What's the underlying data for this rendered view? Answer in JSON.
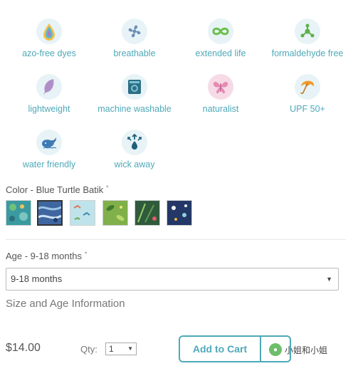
{
  "features": [
    {
      "label": "azo-free dyes",
      "icon": "rainbow-drop-icon"
    },
    {
      "label": "breathable",
      "icon": "fan-icon"
    },
    {
      "label": "extended life",
      "icon": "infinity-icon"
    },
    {
      "label": "formaldehyde free",
      "icon": "molecule-icon"
    },
    {
      "label": "lightweight",
      "icon": "feather-icon"
    },
    {
      "label": "machine washable",
      "icon": "washing-machine-icon"
    },
    {
      "label": "naturalist",
      "icon": "butterfly-icon"
    },
    {
      "label": "UPF 50+",
      "icon": "umbrella-icon"
    },
    {
      "label": "water friendly",
      "icon": "whale-icon"
    },
    {
      "label": "wick away",
      "icon": "drop-arrows-icon"
    }
  ],
  "color": {
    "label": "Color - Blue Turtle Batik",
    "required_mark": "*",
    "swatches": [
      {
        "name": "teal-turtles",
        "color": "#3a9aa0"
      },
      {
        "name": "blue-turtle-batik",
        "color": "#3f66a0"
      },
      {
        "name": "light-blue-birds",
        "color": "#bfe3ea"
      },
      {
        "name": "green-leaves",
        "color": "#7fb04a"
      },
      {
        "name": "dark-green-tropical",
        "color": "#2f5b3c"
      },
      {
        "name": "navy-sea",
        "color": "#233866"
      }
    ],
    "selected_index": 1
  },
  "age": {
    "label": "Age - 9-18 months",
    "required_mark": "*",
    "selected_value": "9-18 months",
    "caret": "▼"
  },
  "size_info_link": "Size and Age Information",
  "price": "$14.00",
  "qty": {
    "label": "Qty:",
    "value": "1",
    "caret": "▼"
  },
  "add_to_cart": "Add to Cart",
  "watermark": {
    "text": "小姐和小姐"
  },
  "colors": {
    "accent": "#4ea9b8",
    "icon_bg": "#e7f3f6"
  }
}
